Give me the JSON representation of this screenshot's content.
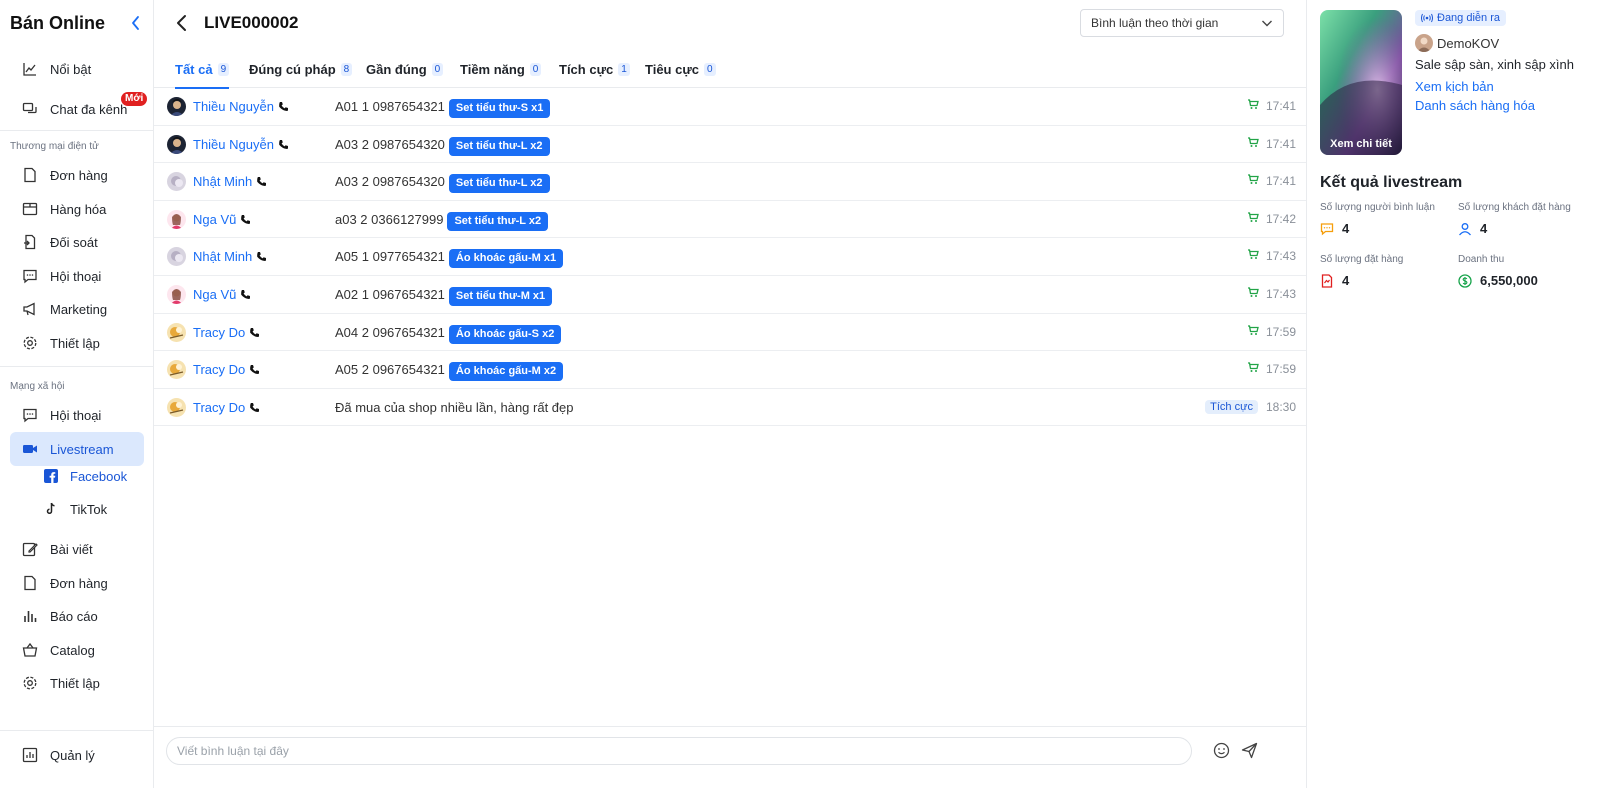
{
  "sidebar": {
    "brand": "Bán Online",
    "items_top": [
      {
        "label": "Nổi bật",
        "icon": "chart-area-icon"
      },
      {
        "label": "Chat đa kênh",
        "icon": "chat-icon",
        "badge": "Mới"
      }
    ],
    "section_ecommerce": "Thương mại điện tử",
    "items_ecommerce": [
      {
        "label": "Đơn hàng",
        "icon": "document-icon"
      },
      {
        "label": "Hàng hóa",
        "icon": "box-icon"
      },
      {
        "label": "Đối soát",
        "icon": "reconcile-icon"
      },
      {
        "label": "Hội thoại",
        "icon": "message-icon"
      },
      {
        "label": "Marketing",
        "icon": "megaphone-icon"
      },
      {
        "label": "Thiết lập",
        "icon": "gear-icon"
      }
    ],
    "section_social": "Mạng xã hội",
    "items_social": [
      {
        "label": "Hội thoại",
        "icon": "message-icon"
      },
      {
        "label": "Livestream",
        "icon": "video-icon",
        "active": true
      }
    ],
    "livestream_sub": [
      {
        "label": "Facebook",
        "icon": "facebook-icon"
      },
      {
        "label": "TikTok",
        "icon": "tiktok-icon"
      }
    ],
    "items_bottom": [
      {
        "label": "Bài viết",
        "icon": "edit-icon"
      },
      {
        "label": "Đơn hàng",
        "icon": "document-icon"
      },
      {
        "label": "Báo cáo",
        "icon": "bar-chart-icon"
      },
      {
        "label": "Catalog",
        "icon": "basket-icon"
      },
      {
        "label": "Thiết lập",
        "icon": "gear-icon"
      }
    ],
    "footer": {
      "label": "Quản lý",
      "icon": "dashboard-icon"
    }
  },
  "header": {
    "title": "LIVE000002",
    "sort_label": "Bình luận theo thời gian"
  },
  "tabs": [
    {
      "label": "Tất cả",
      "count": "9",
      "active": true
    },
    {
      "label": "Đúng cú pháp",
      "count": "8"
    },
    {
      "label": "Gần đúng",
      "count": "0"
    },
    {
      "label": "Tiềm năng",
      "count": "0"
    },
    {
      "label": "Tích cực",
      "count": "1"
    },
    {
      "label": "Tiêu cực",
      "count": "0"
    }
  ],
  "comments": [
    {
      "user": "Thiều Nguyễn",
      "avatar": "dark",
      "text": "A01 1 0987654321",
      "tag": "Set tiểu thư-S x1",
      "time": "17:41",
      "cart": true
    },
    {
      "user": "Thiều Nguyễn",
      "avatar": "dark",
      "text": "A03 2 0987654320",
      "tag": "Set tiểu thư-L x2",
      "time": "17:41",
      "cart": true
    },
    {
      "user": "Nhật Minh",
      "avatar": "grey",
      "text": "A03 2 0987654320",
      "tag": "Set tiểu thư-L x2",
      "time": "17:41",
      "cart": true
    },
    {
      "user": "Nga Vũ",
      "avatar": "pink",
      "text": "a03 2 0366127999",
      "tag": "Set tiểu thư-L x2",
      "time": "17:42",
      "cart": true
    },
    {
      "user": "Nhật Minh",
      "avatar": "grey",
      "text": "A05 1 0977654321",
      "tag": "Áo khoác gấu-M x1",
      "time": "17:43",
      "cart": true
    },
    {
      "user": "Nga Vũ",
      "avatar": "pink",
      "text": "A02 1 0967654321",
      "tag": "Set tiểu thư-M x1",
      "time": "17:43",
      "cart": true
    },
    {
      "user": "Tracy Do",
      "avatar": "yellow",
      "text": "A04 2 0967654321",
      "tag": "Áo khoác gấu-S x2",
      "time": "17:59",
      "cart": true
    },
    {
      "user": "Tracy Do",
      "avatar": "yellow",
      "text": "A05 2 0967654321",
      "tag": "Áo khoác gấu-M x2",
      "time": "17:59",
      "cart": true
    },
    {
      "user": "Tracy Do",
      "avatar": "yellow",
      "text": "Đã mua của shop nhiều lần, hàng rất đẹp",
      "tag": "",
      "sentiment": "Tích cực",
      "time": "18:30",
      "cart": false
    }
  ],
  "composer": {
    "placeholder": "Viết bình luận tại đây"
  },
  "panel": {
    "thumb_label": "Xem chi tiết",
    "status": "Đang diễn ra",
    "host": "DemoKOV",
    "script_title": "Sale sập sàn, xinh sập xình",
    "link_script": "Xem kịch bản",
    "link_products": "Danh sách hàng hóa",
    "results_title": "Kết quả livestream",
    "stats": [
      {
        "label": "Số lượng người bình luận",
        "value": "4",
        "icon": "comment-icon",
        "color": "#f59e0b"
      },
      {
        "label": "Số lượng khách đặt hàng",
        "value": "4",
        "icon": "user-icon",
        "color": "#1a6ef5"
      },
      {
        "label": "Số lượng đặt hàng",
        "value": "4",
        "icon": "order-doc-icon",
        "color": "#e02020"
      },
      {
        "label": "Doanh thu",
        "value": "6,550,000",
        "icon": "dollar-icon",
        "color": "#16a34a"
      }
    ]
  },
  "colors": {
    "accent": "#1a6ef5",
    "active_bg": "#dbe8fd",
    "cart_green": "#22a447",
    "badge_red": "#e02020"
  }
}
